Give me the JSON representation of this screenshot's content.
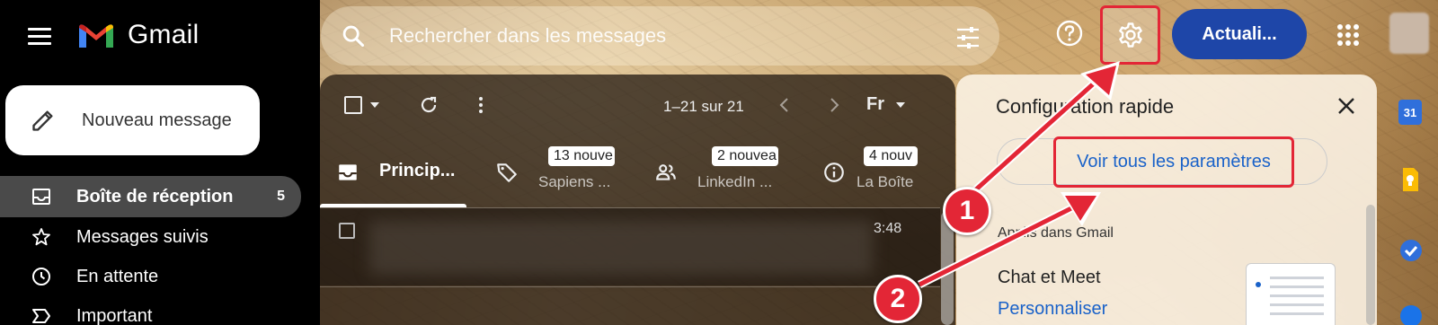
{
  "app": {
    "name": "Gmail"
  },
  "header": {
    "search_placeholder": "Rechercher dans les messages",
    "update_label": "Actuali..."
  },
  "sidebar": {
    "compose_label": "Nouveau message",
    "items": [
      {
        "label": "Boîte de réception",
        "count": "5",
        "icon": "inbox-icon",
        "active": true
      },
      {
        "label": "Messages suivis",
        "icon": "star-icon"
      },
      {
        "label": "En attente",
        "icon": "clock-icon"
      },
      {
        "label": "Important",
        "icon": "important-icon"
      }
    ]
  },
  "list": {
    "range": "1–21 sur 21",
    "lang": "Fr",
    "tabs": [
      {
        "label": "Princip...",
        "icon": "inbox-icon",
        "active": true
      },
      {
        "badge": "13 nouve",
        "sub": "Sapiens ...",
        "icon": "tag-icon"
      },
      {
        "badge": "2 nouvea",
        "sub": "LinkedIn ...",
        "icon": "people-icon"
      },
      {
        "badge": "4 nouv",
        "sub": "La Boîte",
        "icon": "info-icon"
      }
    ],
    "rows": [
      {
        "time": "3:48"
      }
    ]
  },
  "quick_settings": {
    "title": "Configuration rapide",
    "all_settings_label": "Voir tous les paramètres",
    "section_label": "Applis dans Gmail",
    "chat_label": "Chat et Meet",
    "personalize_label": "Personnaliser"
  },
  "side_apps": {
    "calendar_day": "31"
  },
  "annotations": {
    "step1": "1",
    "step2": "2"
  },
  "colors": {
    "accent_red": "#e32636",
    "primary_blue": "#1e46a8",
    "link_blue": "#1a62c9"
  }
}
